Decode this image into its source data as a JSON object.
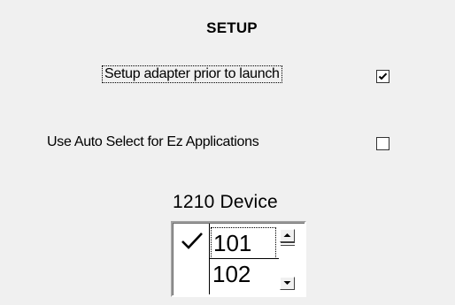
{
  "section": {
    "title": "SETUP"
  },
  "options": {
    "setup_adapter": {
      "label": "Setup adapter prior to launch",
      "checked": true
    },
    "auto_select": {
      "label": "Use Auto Select for Ez Applications",
      "checked": false
    }
  },
  "device": {
    "label": "1210 Device",
    "items": [
      "101",
      "102"
    ],
    "selected": "101"
  },
  "icons": {
    "checkmark": "check-icon",
    "spin_up": "arrow-up-icon",
    "spin_down": "arrow-down-icon"
  }
}
